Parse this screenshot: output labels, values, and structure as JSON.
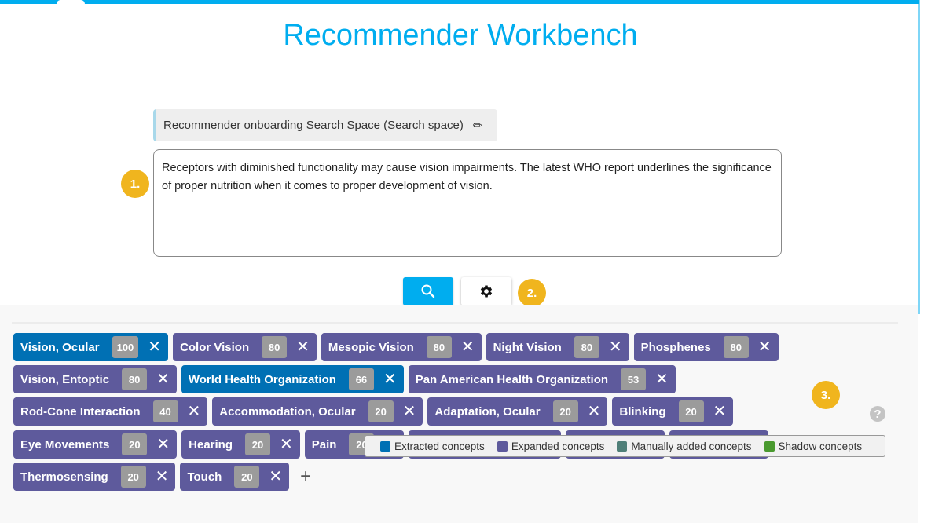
{
  "header": {
    "title": "Recommender Workbench"
  },
  "search_space": {
    "label": "Recommender onboarding Search Space (Search space)",
    "icon": "pencil-icon"
  },
  "query": {
    "value": "Receptors with diminished functionality may cause vision impairments. The latest WHO report underlines the significance of proper nutrition when it comes to proper development of vision."
  },
  "steps": [
    "1.",
    "2.",
    "3."
  ],
  "toolbar": {
    "search_icon": "search-icon",
    "settings_icon": "gear-icon"
  },
  "colors": {
    "accent": "#00adef",
    "extracted": "#0070b4",
    "expanded": "#5e5a9c",
    "manual": "#4f7f78",
    "shadow": "#4a9a2f",
    "step": "#f0b51e"
  },
  "concept_rows": [
    [
      {
        "label": "Vision, Ocular",
        "score": "100",
        "type": "extracted"
      },
      {
        "label": "Color Vision",
        "score": "80",
        "type": "expanded"
      },
      {
        "label": "Mesopic Vision",
        "score": "80",
        "type": "expanded"
      },
      {
        "label": "Night Vision",
        "score": "80",
        "type": "expanded"
      },
      {
        "label": "Phosphenes",
        "score": "80",
        "type": "expanded"
      }
    ],
    [
      {
        "label": "Vision, Entoptic",
        "score": "80",
        "type": "expanded"
      },
      {
        "label": "World Health Organization",
        "score": "66",
        "type": "extracted"
      },
      {
        "label": "Pan American Health Organization",
        "score": "53",
        "type": "expanded"
      }
    ],
    [
      {
        "label": "Rod-Cone Interaction",
        "score": "40",
        "type": "expanded"
      },
      {
        "label": "Accommodation, Ocular",
        "score": "20",
        "type": "expanded"
      },
      {
        "label": "Adaptation, Ocular",
        "score": "20",
        "type": "expanded"
      },
      {
        "label": "Blinking",
        "score": "20",
        "type": "expanded"
      }
    ],
    [
      {
        "label": "Eye Movements",
        "score": "20",
        "type": "expanded"
      },
      {
        "label": "Hearing",
        "score": "20",
        "type": "expanded"
      },
      {
        "label": "Pain",
        "score": "20",
        "type": "expanded"
      }
    ],
    [
      {
        "label": "Thermosensing",
        "score": "20",
        "type": "expanded"
      },
      {
        "label": "Touch",
        "score": "20",
        "type": "expanded"
      }
    ]
  ],
  "add_label": "+",
  "legend": [
    {
      "label": "Extracted concepts",
      "color": "#0070b4"
    },
    {
      "label": "Expanded concepts",
      "color": "#5e5a9c"
    },
    {
      "label": "Manually added concepts",
      "color": "#4f7f78"
    },
    {
      "label": "Shadow concepts",
      "color": "#4a9a2f"
    }
  ],
  "help_label": "?"
}
